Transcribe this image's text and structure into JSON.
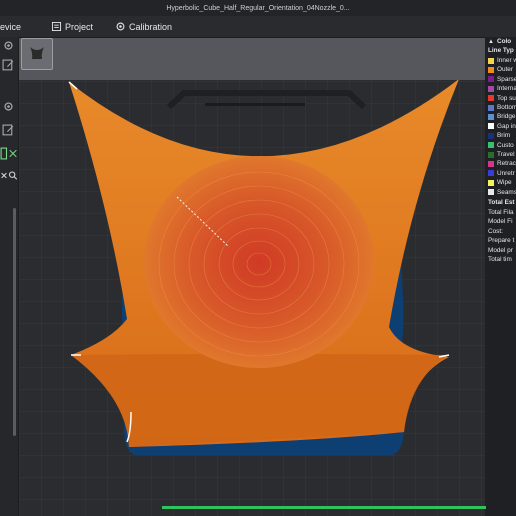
{
  "window": {
    "title": "Hyperbolic_Cube_Half_Regular_Orientation_04Nozzle_0..."
  },
  "menubar": {
    "device_label": "evice",
    "project_label": "Project",
    "calibration_label": "Calibration"
  },
  "legend": {
    "header": "Colo",
    "line_type_label": "Line Typ",
    "items": [
      {
        "label": "Inner w",
        "color": "#f7d44a"
      },
      {
        "label": "Outer",
        "color": "#f28a1e"
      },
      {
        "label": "Sparse",
        "color": "#7c1c8a"
      },
      {
        "label": "Interna",
        "color": "#a24aa8"
      },
      {
        "label": "Top su",
        "color": "#e23b2e"
      },
      {
        "label": "Bottom",
        "color": "#5a78c8"
      },
      {
        "label": "Bridge",
        "color": "#5e8fd6"
      },
      {
        "label": "Gap in",
        "color": "#ffffff"
      },
      {
        "label": "Brim",
        "color": "#1c2f7a"
      },
      {
        "label": "Custo",
        "color": "#36c26e"
      },
      {
        "label": "Travel",
        "color": "#2a6d2a"
      },
      {
        "label": "Retrac",
        "color": "#d3378b"
      },
      {
        "label": "Unretr",
        "color": "#3b3bd6"
      },
      {
        "label": "Wipe",
        "color": "#f3f35a"
      },
      {
        "label": "Seams",
        "color": "#e9e9e9"
      }
    ],
    "estimate_header": "Total Est",
    "estimate_rows": [
      "Total Fila",
      "Model Fi",
      "Cost:",
      "Prepare t",
      "Model pr",
      "Total tim"
    ]
  },
  "colors": {
    "accent_green": "#2ec35f",
    "model_orange": "#e07b1c",
    "top_red": "#d24a1e",
    "brim_blue": "#0e3f73"
  }
}
